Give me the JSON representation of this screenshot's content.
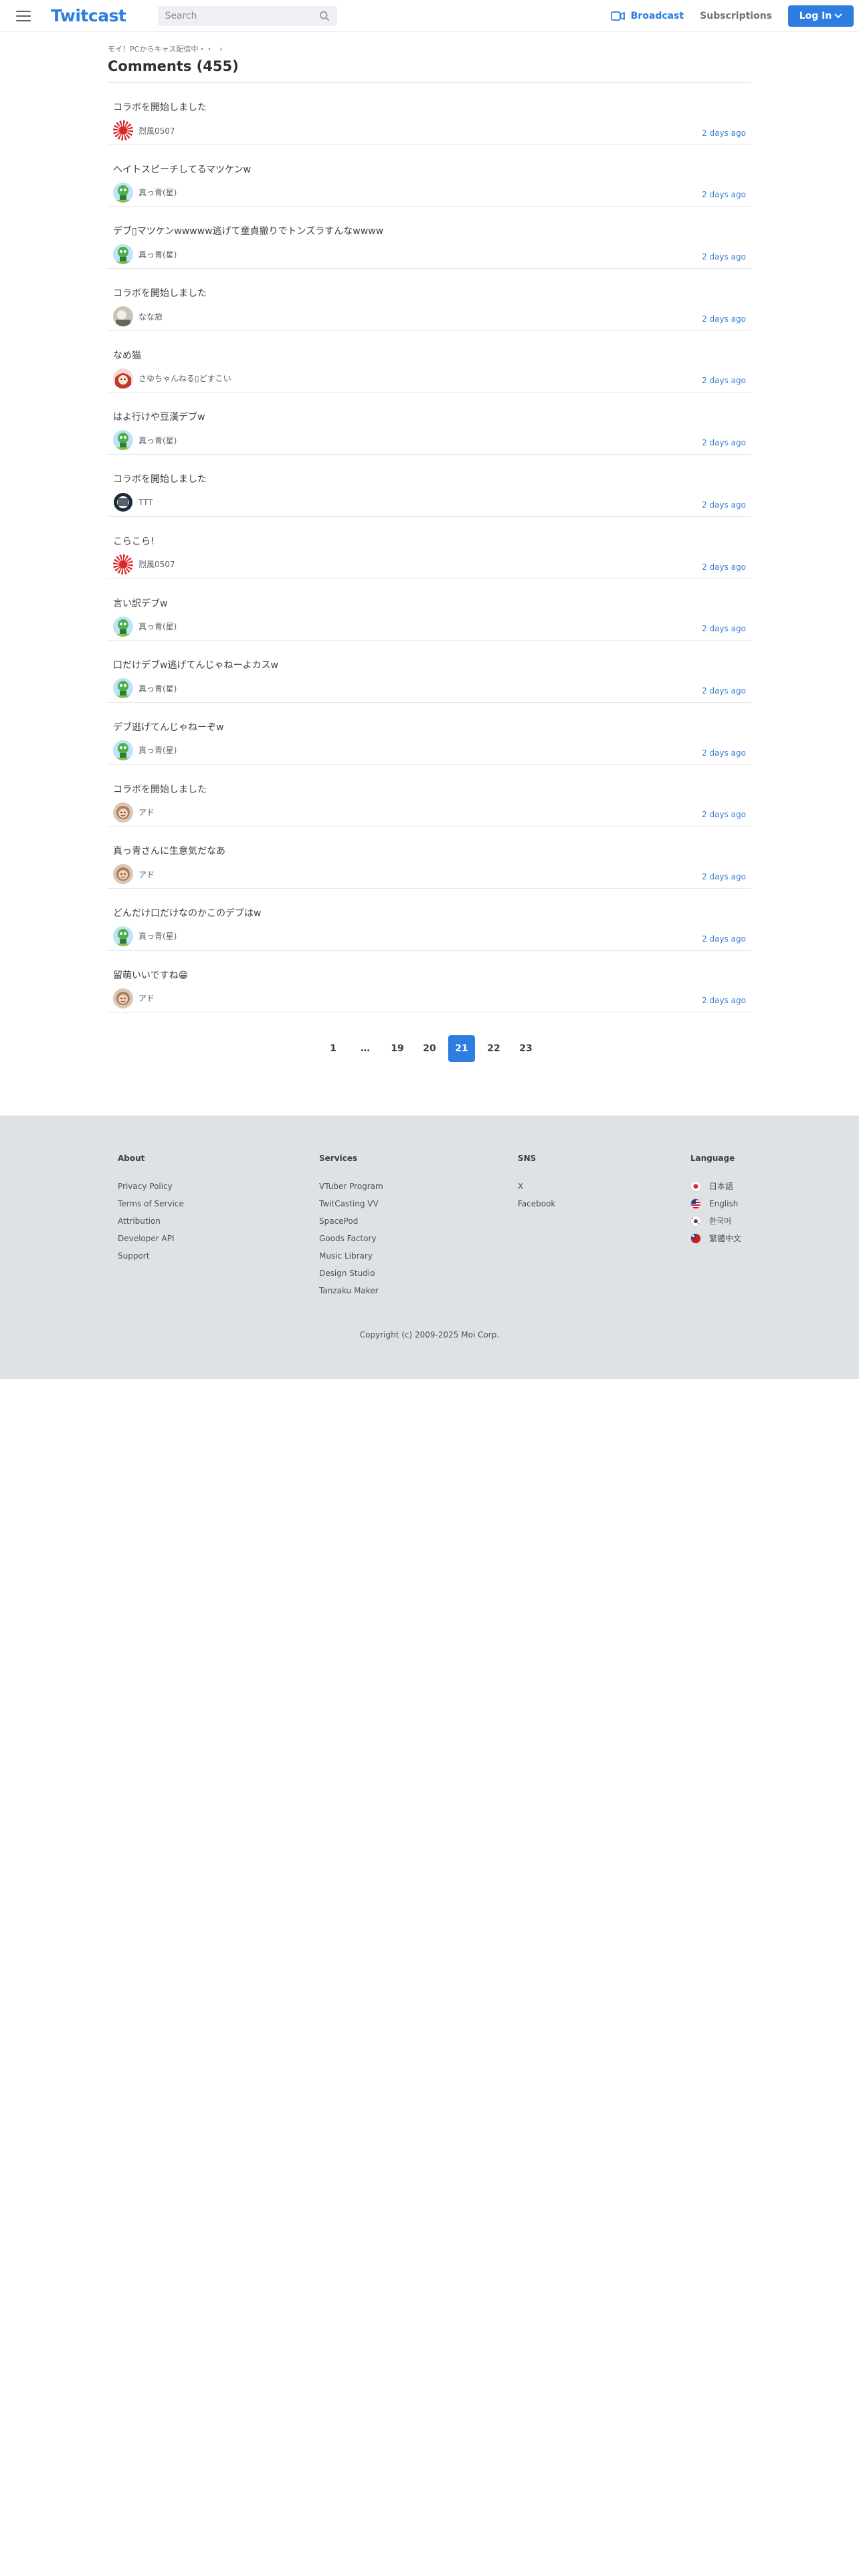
{
  "header": {
    "logo": "Twitcast",
    "search_placeholder": "Search",
    "broadcast_label": "Broadcast",
    "subscriptions_label": "Subscriptions",
    "login_label": "Log In"
  },
  "breadcrumb": {
    "text": "モイ！PCからキャス配信中・・",
    "chevron": "›"
  },
  "page_title": "Comments (455)",
  "comments": [
    {
      "text": "コラボを開始しました",
      "user": "烈風0507",
      "time": "2 days ago",
      "avatar": "rising-sun"
    },
    {
      "text": "ヘイトスピーチしてるマツケンw",
      "user": "真っ青(星)",
      "time": "2 days ago",
      "avatar": "green-char"
    },
    {
      "text": "デブ▯マツケンwwwww逃げて童貞撤りでトンズラすんなwwww",
      "user": "真っ青(星)",
      "time": "2 days ago",
      "avatar": "green-char"
    },
    {
      "text": "コラボを開始しました",
      "user": "なな旅",
      "time": "2 days ago",
      "avatar": "photo-gray"
    },
    {
      "text": "なめ猫",
      "user": "さゆちゃんねる▯どすこい",
      "time": "2 days ago",
      "avatar": "anime-red"
    },
    {
      "text": "はよ行けや豆漢デブw",
      "user": "真っ青(星)",
      "time": "2 days ago",
      "avatar": "green-char"
    },
    {
      "text": "コラボを開始しました",
      "user": "TTT",
      "time": "2 days ago",
      "avatar": "pattern-bw"
    },
    {
      "text": "こらこら!",
      "user": "烈風0507",
      "time": "2 days ago",
      "avatar": "rising-sun"
    },
    {
      "text": "言い訳デブw",
      "user": "真っ青(星)",
      "time": "2 days ago",
      "avatar": "green-char"
    },
    {
      "text": "口だけデブw逃げてんじゃねーよカスw",
      "user": "真っ青(星)",
      "time": "2 days ago",
      "avatar": "green-char"
    },
    {
      "text": "デブ逃げてんじゃねーぞw",
      "user": "真っ青(星)",
      "time": "2 days ago",
      "avatar": "green-char"
    },
    {
      "text": "コラボを開始しました",
      "user": "アド",
      "time": "2 days ago",
      "avatar": "face-brown"
    },
    {
      "text": "真っ青さんに生意気だなあ",
      "user": "アド",
      "time": "2 days ago",
      "avatar": "face-brown"
    },
    {
      "text": "どんだけ口だけなのかこのデブはw",
      "user": "真っ青(星)",
      "time": "2 days ago",
      "avatar": "green-char"
    },
    {
      "text": "留萌いいですね😁",
      "user": "アド",
      "time": "2 days ago",
      "avatar": "face-brown"
    }
  ],
  "pagination": {
    "pages": [
      "1",
      "…",
      "19",
      "20",
      "21",
      "22",
      "23"
    ],
    "current": "21"
  },
  "footer": {
    "about": {
      "heading": "About",
      "links": [
        "Privacy Policy",
        "Terms of Service",
        "Attribution",
        "Developer API",
        "Support"
      ]
    },
    "services": {
      "heading": "Services",
      "links": [
        "VTuber Program",
        "TwitCasting VV",
        "SpacePod",
        "Goods Factory",
        "Music Library",
        "Design Studio",
        "Tanzaku Maker"
      ]
    },
    "sns": {
      "heading": "SNS",
      "links": [
        "X",
        "Facebook"
      ]
    },
    "language": {
      "heading": "Language",
      "items": [
        {
          "label": "日本語",
          "flag": "jp-flag-icon"
        },
        {
          "label": "English",
          "flag": "us-flag-icon"
        },
        {
          "label": "한국어",
          "flag": "kr-flag-icon"
        },
        {
          "label": "繁體中文",
          "flag": "tw-flag-icon"
        }
      ]
    },
    "copyright": "Copyright (c) 2009-2025 Moi Corp."
  },
  "colors": {
    "accent": "#2d7ee0",
    "link_time": "#3b7fd4",
    "footer_bg": "#dfe2e5"
  }
}
